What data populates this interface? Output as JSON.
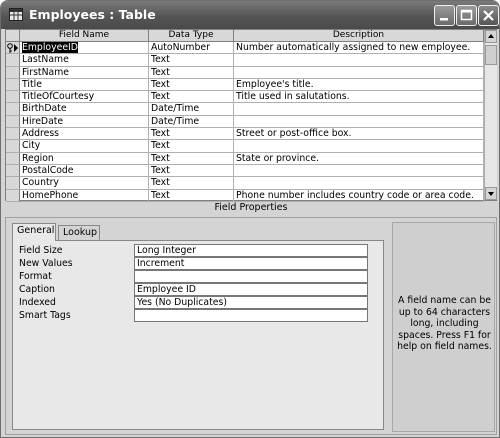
{
  "window": {
    "title": "Employees : Table"
  },
  "grid": {
    "headers": [
      "Field Name",
      "Data Type",
      "Description"
    ],
    "rows": [
      {
        "field": "EmployeeID",
        "type": "AutoNumber",
        "desc": "Number automatically assigned to new employee."
      },
      {
        "field": "LastName",
        "type": "Text",
        "desc": ""
      },
      {
        "field": "FirstName",
        "type": "Text",
        "desc": ""
      },
      {
        "field": "Title",
        "type": "Text",
        "desc": "Employee's title."
      },
      {
        "field": "TitleOfCourtesy",
        "type": "Text",
        "desc": "Title used in salutations."
      },
      {
        "field": "BirthDate",
        "type": "Date/Time",
        "desc": ""
      },
      {
        "field": "HireDate",
        "type": "Date/Time",
        "desc": ""
      },
      {
        "field": "Address",
        "type": "Text",
        "desc": "Street or post-office box."
      },
      {
        "field": "City",
        "type": "Text",
        "desc": ""
      },
      {
        "field": "Region",
        "type": "Text",
        "desc": "State or province."
      },
      {
        "field": "PostalCode",
        "type": "Text",
        "desc": ""
      },
      {
        "field": "Country",
        "type": "Text",
        "desc": ""
      },
      {
        "field": "HomePhone",
        "type": "Text",
        "desc": "Phone number includes country code or area code."
      }
    ]
  },
  "field_properties_label": "Field Properties",
  "tabs": {
    "general": "General",
    "lookup": "Lookup"
  },
  "properties": [
    {
      "label": "Field Size",
      "value": "Long Integer"
    },
    {
      "label": "New Values",
      "value": "Increment"
    },
    {
      "label": "Format",
      "value": ""
    },
    {
      "label": "Caption",
      "value": "Employee ID"
    },
    {
      "label": "Indexed",
      "value": "Yes (No Duplicates)"
    },
    {
      "label": "Smart Tags",
      "value": ""
    }
  ],
  "help_text": "A field name can be up to 64 characters long, including spaces.  Press F1 for help on field names.",
  "icons": {
    "window": "table-icon",
    "primary_key": "key-icon",
    "current_row": "row-pointer-icon",
    "minimize": "minimize-icon",
    "maximize": "maximize-icon",
    "close": "close-icon"
  }
}
